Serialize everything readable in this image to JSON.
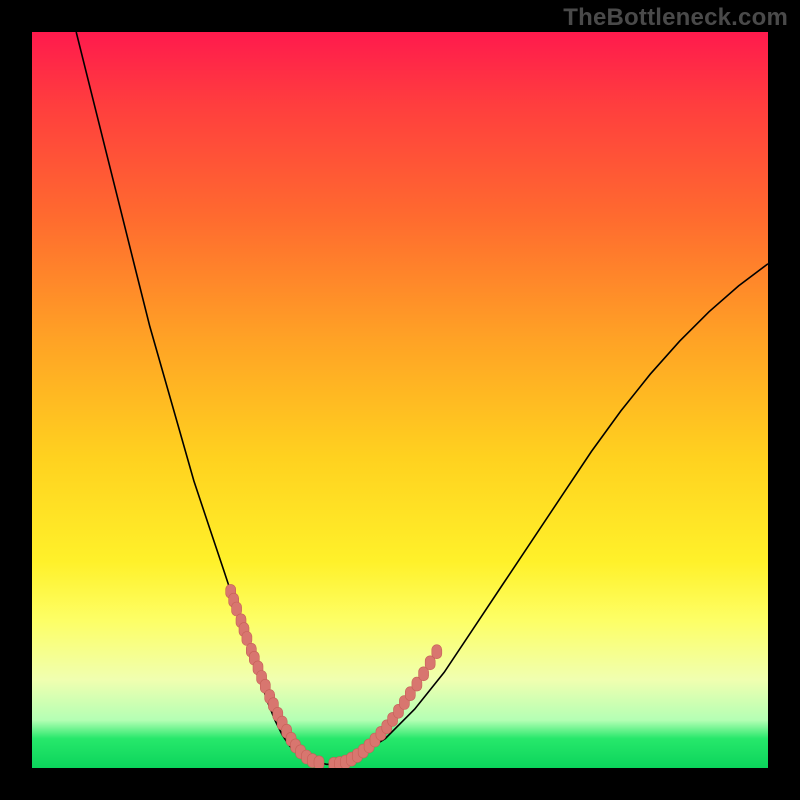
{
  "watermark": "TheBottleneck.com",
  "colors": {
    "frame": "#000000",
    "curve": "#000000",
    "dot_fill": "#d8766f",
    "dot_stroke": "#c66058",
    "gradient_stops": [
      "#ff1a4d",
      "#ff3e3e",
      "#ff6a2f",
      "#ffa325",
      "#ffd21f",
      "#fff12a",
      "#fdff66",
      "#f0ffb0",
      "#b4ffb4",
      "#27e86b",
      "#0bd45b"
    ]
  },
  "chart_data": {
    "type": "line",
    "title": "",
    "xlabel": "",
    "ylabel": "",
    "xlim": [
      0,
      100
    ],
    "ylim": [
      0,
      100
    ],
    "grid": false,
    "legend": false,
    "series": [
      {
        "name": "bottleneck-curve",
        "x": [
          6,
          8,
          10,
          12,
          14,
          16,
          18,
          20,
          22,
          24,
          26,
          27,
          28,
          29,
          30,
          31,
          32,
          33,
          34,
          35,
          36,
          38,
          40,
          42,
          44,
          48,
          52,
          56,
          60,
          64,
          68,
          72,
          76,
          80,
          84,
          88,
          92,
          96,
          100
        ],
        "y": [
          100,
          92,
          84,
          76,
          68,
          60,
          53,
          46,
          39,
          33,
          27,
          24,
          21,
          18,
          15,
          12,
          9,
          6.5,
          4.5,
          3,
          2,
          1,
          0.5,
          0.5,
          1.5,
          4,
          8,
          13,
          19,
          25,
          31,
          37,
          43,
          48.5,
          53.5,
          58,
          62,
          65.5,
          68.5
        ]
      }
    ],
    "dot_clusters": [
      {
        "name": "left-cluster",
        "x": [
          27.0,
          27.4,
          27.8,
          28.4,
          28.8,
          29.2,
          29.8,
          30.2,
          30.7,
          31.2,
          31.7,
          32.3,
          32.8,
          33.4,
          34.0,
          34.6,
          35.2,
          35.8,
          36.5,
          37.3,
          38.1,
          39.0
        ],
        "y": [
          24.0,
          22.8,
          21.6,
          20.0,
          18.8,
          17.6,
          16.0,
          14.9,
          13.6,
          12.3,
          11.1,
          9.7,
          8.6,
          7.3,
          6.1,
          5.0,
          3.9,
          3.0,
          2.2,
          1.5,
          1.0,
          0.7
        ]
      },
      {
        "name": "right-cluster",
        "x": [
          41.0,
          41.8,
          42.6,
          43.4,
          44.2,
          45.0,
          45.8,
          46.6,
          47.4,
          48.2,
          49.0,
          49.8,
          50.6,
          51.4,
          52.3,
          53.2,
          54.1,
          55.0
        ],
        "y": [
          0.5,
          0.6,
          0.8,
          1.2,
          1.7,
          2.3,
          3.0,
          3.8,
          4.7,
          5.6,
          6.6,
          7.7,
          8.9,
          10.1,
          11.4,
          12.8,
          14.3,
          15.8
        ]
      }
    ]
  }
}
